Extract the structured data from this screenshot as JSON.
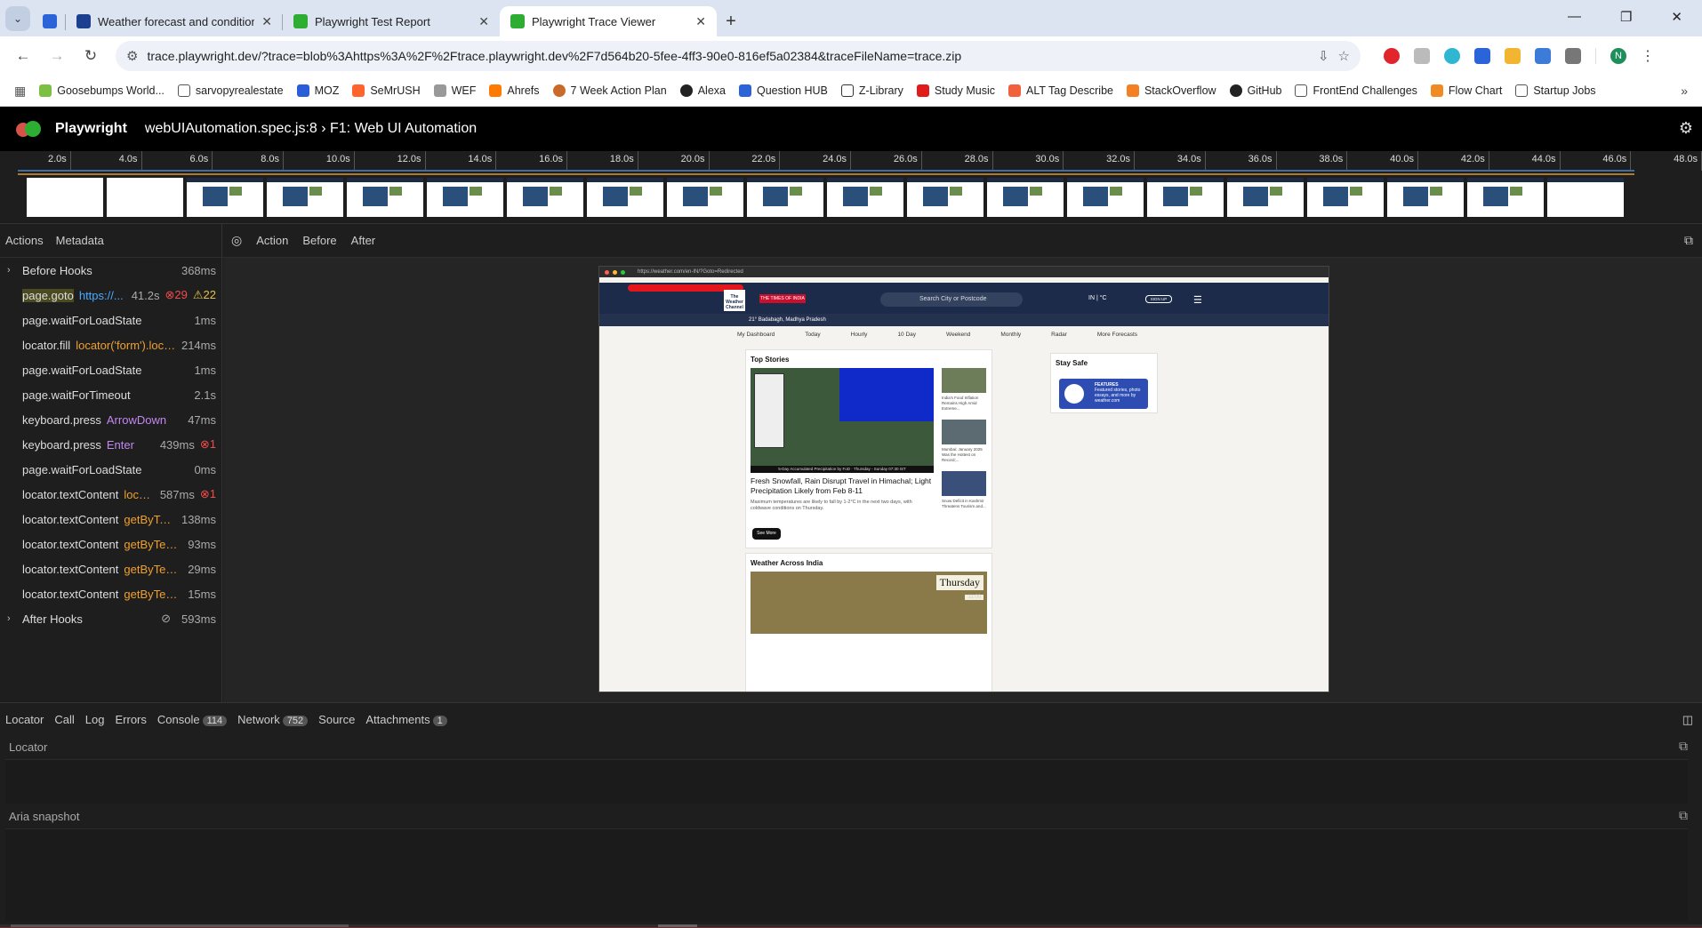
{
  "tabs": [
    {
      "title": "",
      "active": false
    },
    {
      "title": "Weather forecast and conditions",
      "active": false
    },
    {
      "title": "Playwright Test Report",
      "active": false
    },
    {
      "title": "Playwright Trace Viewer",
      "active": true
    }
  ],
  "address": {
    "url": "trace.playwright.dev/?trace=blob%3Ahttps%3A%2F%2Ftrace.playwright.dev%2F7d564b20-5fee-4ff3-90e0-816ef5a02384&traceFileName=trace.zip"
  },
  "bookmarks": [
    "Goosebumps World...",
    "sarvopyrealestate",
    "MOZ",
    "SeMrUSH",
    "WEF",
    "Ahrefs",
    "7 Week Action Plan",
    "Alexa",
    "Question HUB",
    "Z-Library",
    "Study Music",
    "ALT Tag Describe",
    "StackOverflow",
    "GitHub",
    "FrontEnd Challenges",
    "Flow Chart",
    "Startup Jobs"
  ],
  "profile_initial": "N",
  "app": {
    "brand": "Playwright",
    "title": "webUIAutomation.spec.js:8 › F1: Web UI Automation"
  },
  "timeline": {
    "ticks": [
      "2.0s",
      "4.0s",
      "6.0s",
      "8.0s",
      "10.0s",
      "12.0s",
      "14.0s",
      "16.0s",
      "18.0s",
      "20.0s",
      "22.0s",
      "24.0s",
      "26.0s",
      "28.0s",
      "30.0s",
      "32.0s",
      "34.0s",
      "36.0s",
      "38.0s",
      "40.0s",
      "42.0s",
      "44.0s",
      "46.0s",
      "48.0s"
    ]
  },
  "left_tabs": {
    "actions": "Actions",
    "metadata": "Metadata"
  },
  "actions": [
    {
      "name": "Before Hooks",
      "param": "",
      "duration": "368ms",
      "group": true
    },
    {
      "name": "page.goto",
      "param": "https://...",
      "duration": "41.2s",
      "errors": "29",
      "warnings": "22",
      "selected": true,
      "color": "blue"
    },
    {
      "name": "page.waitForLoadState",
      "param": "",
      "duration": "1ms"
    },
    {
      "name": "locator.fill",
      "param": "locator('form').loca...",
      "duration": "214ms",
      "color": "orange"
    },
    {
      "name": "page.waitForLoadState",
      "param": "",
      "duration": "1ms"
    },
    {
      "name": "page.waitForTimeout",
      "param": "",
      "duration": "2.1s"
    },
    {
      "name": "keyboard.press",
      "param": "ArrowDown",
      "duration": "47ms",
      "color": "purple"
    },
    {
      "name": "keyboard.press",
      "param": "Enter",
      "duration": "439ms",
      "errors": "1",
      "color": "purple"
    },
    {
      "name": "page.waitForLoadState",
      "param": "",
      "duration": "0ms"
    },
    {
      "name": "locator.textContent",
      "param": "loca...",
      "duration": "587ms",
      "errors": "1",
      "color": "orange"
    },
    {
      "name": "locator.textContent",
      "param": "getByTes...",
      "duration": "138ms",
      "color": "orange"
    },
    {
      "name": "locator.textContent",
      "param": "getByTestI...",
      "duration": "93ms",
      "color": "orange"
    },
    {
      "name": "locator.textContent",
      "param": "getByTestI...",
      "duration": "29ms",
      "color": "orange"
    },
    {
      "name": "locator.textContent",
      "param": "getByTestI...",
      "duration": "15ms",
      "color": "orange"
    },
    {
      "name": "After Hooks",
      "param": "",
      "duration": "593ms",
      "group": true,
      "attachment": true
    }
  ],
  "view_tabs": {
    "action": "Action",
    "before": "Before",
    "after": "After"
  },
  "snapshot": {
    "url": "https://weather.com/en-IN/?Goto=Redirected",
    "toi": "THE TIMES OF INDIA",
    "logo": "The Weather Channel",
    "search": "Search City or Postcode",
    "unit": "IN | °C",
    "signup": "SIGN UP",
    "location": "21° Badabagh, Madhya Pradesh",
    "nav": [
      "My Dashboard",
      "Today",
      "Hourly",
      "10 Day",
      "Weekend",
      "Monthly",
      "Radar",
      "More Forecasts"
    ],
    "top_stories": "Top Stories",
    "map_caption": "5-Day Accumulated Precipitation by FoD · Thursday - Sunday 07:30 IST",
    "headline": "Fresh Snowfall, Rain Disrupt Travel in Himachal; Light Precipitation Likely from Feb 8-11",
    "summary": "Maximum temperatures are likely to fall by 1-2°C in the next two days, with coldwave conditions on Thursday.",
    "see_more": "See More",
    "side_stories": [
      "India's Food Inflation Remains High Amid Extreme...",
      "Mumbai: January 2025 Was the Hottest on Record;...",
      "Snow Deficit in Kashmir Threatens Tourism and..."
    ],
    "stay_safe": "Stay Safe",
    "features_tag": "FEATURES",
    "features_text": "Featured stories, photo essays, and more by weather.com",
    "across_india": "Weather Across India",
    "day": "Thursday",
    "time": "11:00"
  },
  "bottom_tabs": [
    {
      "label": "Locator",
      "count": ""
    },
    {
      "label": "Call",
      "count": ""
    },
    {
      "label": "Log",
      "count": ""
    },
    {
      "label": "Errors",
      "count": ""
    },
    {
      "label": "Console",
      "count": "114"
    },
    {
      "label": "Network",
      "count": "752"
    },
    {
      "label": "Source",
      "count": ""
    },
    {
      "label": "Attachments",
      "count": "1"
    }
  ],
  "locator_label": "Locator",
  "aria_label": "Aria snapshot"
}
